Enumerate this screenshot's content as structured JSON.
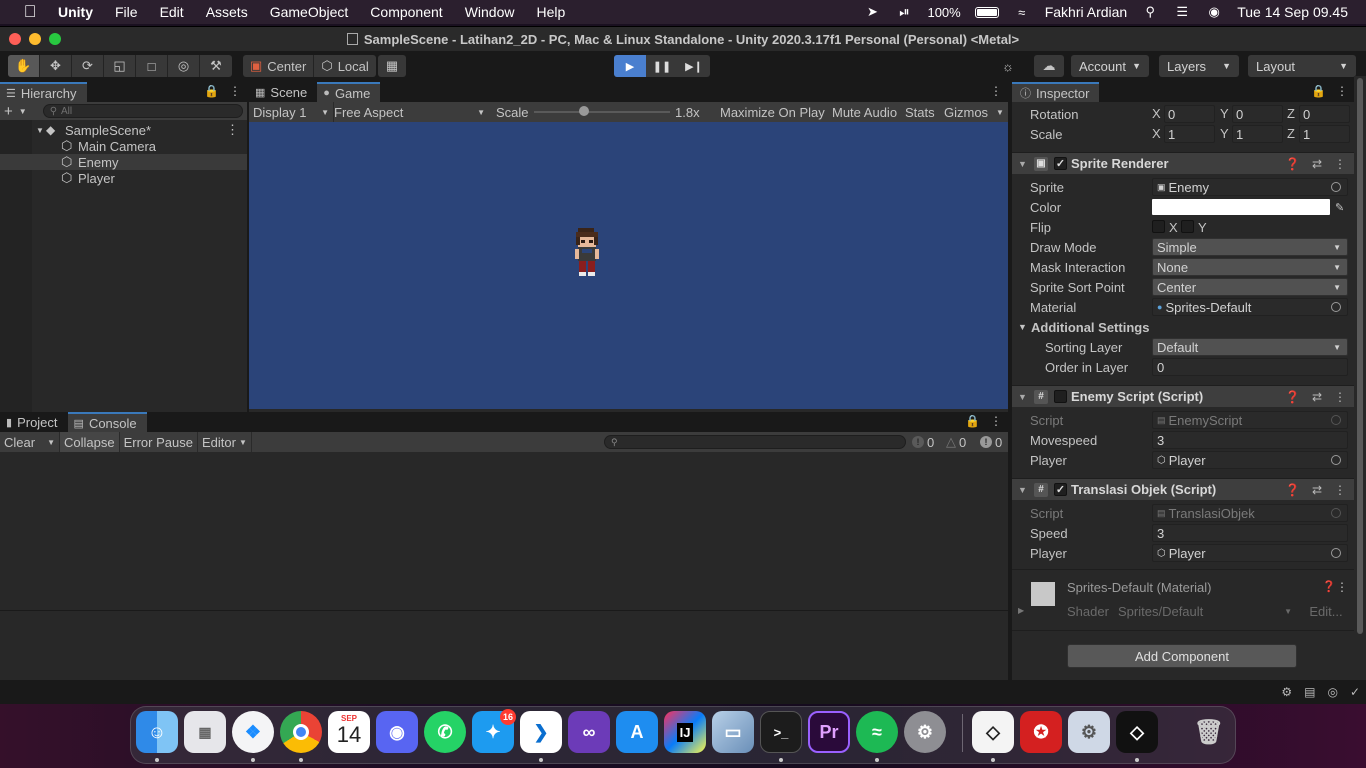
{
  "menubar": {
    "app": "Unity",
    "items": [
      "File",
      "Edit",
      "Assets",
      "GameObject",
      "Component",
      "Window",
      "Help"
    ],
    "battery": "100%",
    "user": "Fakhri Ardian",
    "datetime": "Tue 14 Sep  09.45"
  },
  "window": {
    "title": "SampleScene - Latihan2_2D - PC, Mac & Linux Standalone - Unity 2020.3.17f1 Personal (Personal) <Metal>"
  },
  "toolbar": {
    "pivot": "Center",
    "space": "Local",
    "account": "Account",
    "layers": "Layers",
    "layout": "Layout"
  },
  "hierarchy": {
    "tab": "Hierarchy",
    "search_placeholder": "All",
    "scene": "SampleScene*",
    "items": [
      "Main Camera",
      "Enemy",
      "Player"
    ]
  },
  "game": {
    "tabs": [
      "Scene",
      "Game"
    ],
    "display": "Display 1",
    "aspect": "Free Aspect",
    "scale_label": "Scale",
    "scale_value": "1.8x",
    "maximize": "Maximize On Play",
    "mute": "Mute Audio",
    "stats": "Stats",
    "gizmos": "Gizmos"
  },
  "console": {
    "tabs": [
      "Project",
      "Console"
    ],
    "clear": "Clear",
    "collapse": "Collapse",
    "error_pause": "Error Pause",
    "editor": "Editor",
    "counts": [
      "0",
      "0",
      "0"
    ]
  },
  "inspector": {
    "tab": "Inspector",
    "transform": {
      "rotation_label": "Rotation",
      "rotation": [
        "0",
        "0",
        "0"
      ],
      "scale_label": "Scale",
      "scale": [
        "1",
        "1",
        "1"
      ]
    },
    "sprite_renderer": {
      "title": "Sprite Renderer",
      "sprite_label": "Sprite",
      "sprite": "Enemy",
      "color_label": "Color",
      "color": "#ffffff",
      "flip_label": "Flip",
      "flip_x": "X",
      "flip_y": "Y",
      "draw_mode_label": "Draw Mode",
      "draw_mode": "Simple",
      "mask_label": "Mask Interaction",
      "mask": "None",
      "sort_point_label": "Sprite Sort Point",
      "sort_point": "Center",
      "material_label": "Material",
      "material": "Sprites-Default",
      "additional": "Additional Settings",
      "sorting_layer_label": "Sorting Layer",
      "sorting_layer": "Default",
      "order_label": "Order in Layer",
      "order": "0"
    },
    "enemy_script": {
      "title": "Enemy Script (Script)",
      "script_label": "Script",
      "script": "EnemyScript",
      "movespeed_label": "Movespeed",
      "movespeed": "3",
      "player_label": "Player",
      "player": "Player"
    },
    "translasi": {
      "title": "Translasi Objek (Script)",
      "script_label": "Script",
      "script": "TranslasiObjek",
      "speed_label": "Speed",
      "speed": "3",
      "player_label": "Player",
      "player": "Player"
    },
    "material": {
      "title": "Sprites-Default (Material)",
      "shader_label": "Shader",
      "shader": "Sprites/Default",
      "edit": "Edit..."
    },
    "add_component": "Add Component"
  },
  "dock": {
    "calendar_month": "SEP",
    "calendar_day": "14",
    "twitter_badge": "16",
    "intellij": "IJ",
    "premiere": "Pr"
  }
}
